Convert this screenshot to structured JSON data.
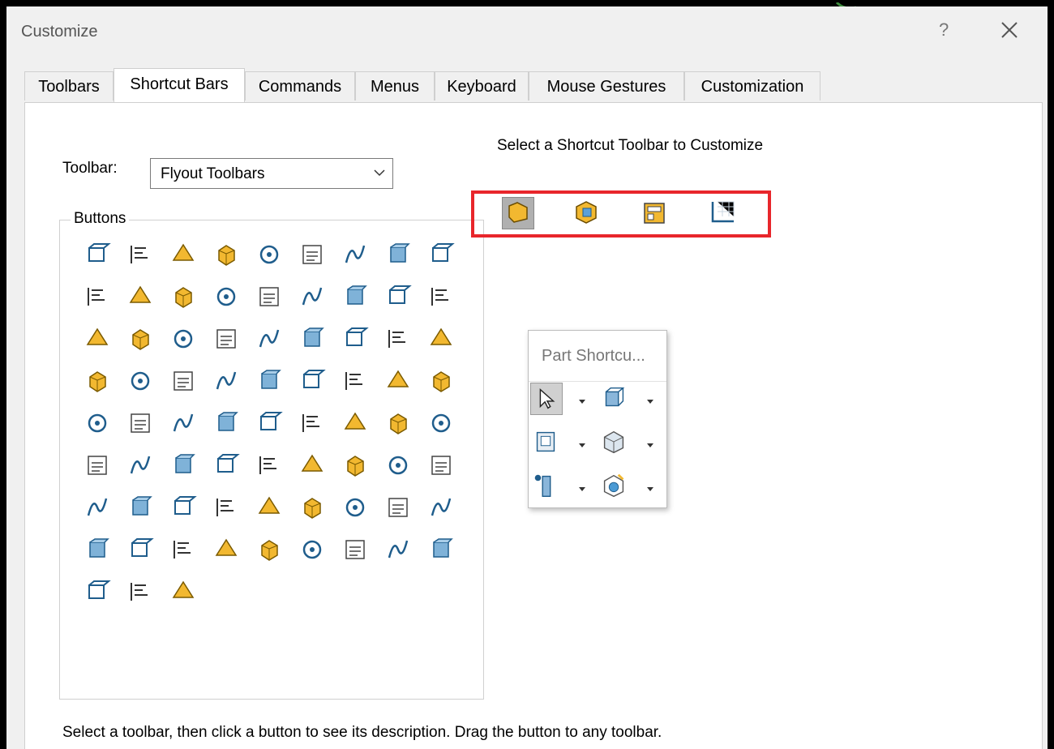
{
  "dialog": {
    "title": "Customize",
    "help_label": "?"
  },
  "tabs": [
    {
      "label": "Toolbars"
    },
    {
      "label": "Shortcut Bars"
    },
    {
      "label": "Commands"
    },
    {
      "label": "Menus"
    },
    {
      "label": "Keyboard"
    },
    {
      "label": "Mouse Gestures"
    },
    {
      "label": "Customization"
    }
  ],
  "active_tab": "Shortcut Bars",
  "toolbar_selector": {
    "label": "Toolbar:",
    "value": "Flyout Toolbars"
  },
  "buttons_group": {
    "label": "Buttons",
    "icons": [
      "assembly-component-icon",
      "align-left-icon",
      "annotation-text-icon",
      "part-3d-icon",
      "part-gold-icon",
      "note-a-icon",
      "curve-u-icon",
      "layout-tree-icon",
      "crosshair-icon",
      "drawing-sheet-icon",
      "feature-tag-icon",
      "solid-body-icon",
      "bom-table-icon",
      "sketch-plane-icon",
      "color-bar-icon",
      "file-play-icon",
      "section-view-icon",
      "circle-view-icon",
      "reference-plane-icon",
      "appearance-ball-icon",
      "camera-icon",
      "filter-icon",
      "window-icon",
      "display-monitor-icon",
      "grid-sketch-icon",
      "sw-addin-icon",
      "spline-icon",
      "save-file-icon",
      "cube-plus-icon",
      "surface-flag-icon",
      "table-grid-icon",
      "toolbox-icon",
      "zoom-icon",
      "globe-icon",
      "rebuild-icon",
      "new-document-icon",
      "open-folder-icon",
      "save-disk-icon",
      "print-icon",
      "gear-icon",
      "grid-corner-icon",
      "line-icon",
      "rectangle-icon",
      "slot-icon",
      "circle-icon",
      "arc-icon",
      "ellipse-icon",
      "spline-curve-icon",
      "fillet-icon",
      "box-icon",
      "trim-icon",
      "move-entities-icon",
      "pattern-icon",
      "perpendicular-icon",
      "direction-icon",
      "component-icon",
      "frame-icon",
      "shaded-box-icon",
      "linear-pattern-icon",
      "sheet-metal-icon",
      "open-assembly-icon",
      "mirror-pattern-icon",
      "replace-icon",
      "hole-wizard-icon",
      "swap-icon",
      "text-size-icon",
      "display-icon",
      "check-x-icon",
      "fasteners-icon",
      "insert-part-icon",
      "weldment-icon",
      "blue-cube-icon",
      "instant3d-icon",
      "dimension-icon",
      "buildings-icon"
    ]
  },
  "shortcut_section": {
    "heading": "Select a Shortcut Toolbar to Customize",
    "toolbars": [
      {
        "icon": "part-shortcut-icon",
        "selected": true
      },
      {
        "icon": "assembly-shortcut-icon",
        "selected": false
      },
      {
        "icon": "drawing-shortcut-icon",
        "selected": false
      },
      {
        "icon": "sketch-shortcut-icon",
        "selected": false
      }
    ]
  },
  "preview": {
    "title": "Part Shortcu...",
    "buttons": [
      {
        "icon": "select-arrow-icon",
        "selected": true
      },
      {
        "icon": "view-orientation-icon",
        "selected": false
      },
      {
        "icon": "hide-show-icon",
        "selected": false
      },
      {
        "icon": "display-style-icon",
        "selected": false
      },
      {
        "icon": "reference-geometry-icon",
        "selected": false
      },
      {
        "icon": "instant3d-icon",
        "selected": false
      }
    ]
  },
  "status_text": "Select a toolbar, then click a button to see its description. Drag the button to any toolbar.",
  "colors": {
    "accent_red": "#e8262b",
    "icon_blue": "#1f5d8c",
    "icon_gold": "#f2b830"
  }
}
